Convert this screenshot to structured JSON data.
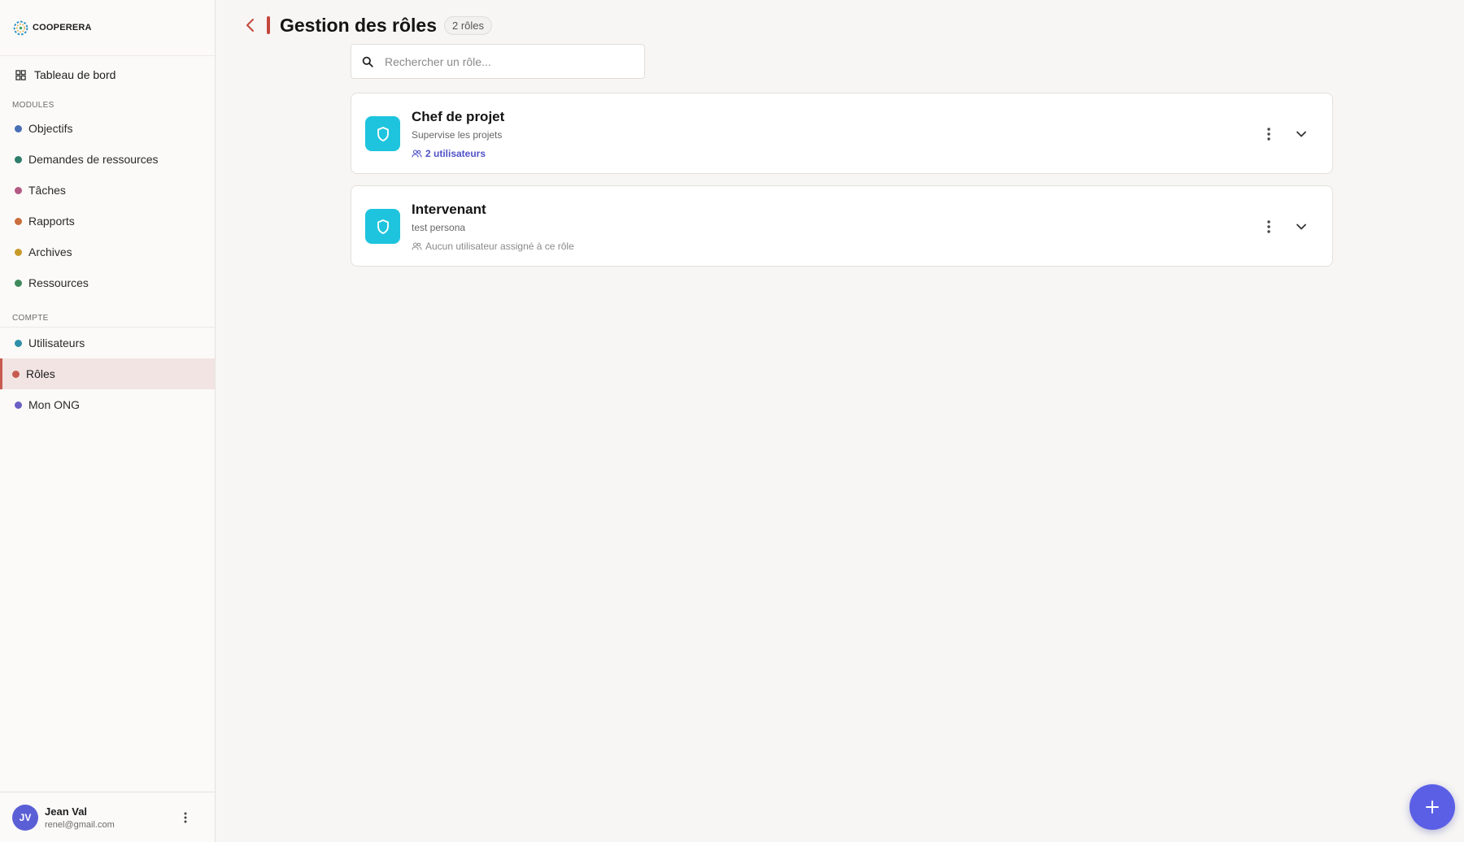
{
  "brand": {
    "name": "COOPERERA",
    "icon": "cooperera-logo"
  },
  "sidebar": {
    "dashboard": {
      "label": "Tableau de bord",
      "icon": "grid-icon"
    },
    "modules_title": "MODULES",
    "modules": [
      {
        "label": "Objectifs",
        "color": "#4a6fb5"
      },
      {
        "label": "Demandes de ressources",
        "color": "#2f7d6d"
      },
      {
        "label": "Tâches",
        "color": "#b35a84"
      },
      {
        "label": "Rapports",
        "color": "#c96e3c"
      },
      {
        "label": "Archives",
        "color": "#c89a2a"
      },
      {
        "label": "Ressources",
        "color": "#3f8a5c"
      }
    ],
    "compte_title": "COMPTE",
    "compte": [
      {
        "label": "Utilisateurs",
        "color": "#2f8fa8"
      },
      {
        "label": "Rôles",
        "color": "#c75a4f",
        "active": true
      },
      {
        "label": "Mon ONG",
        "color": "#6a5fc4"
      }
    ]
  },
  "user": {
    "initials": "JV",
    "name": "Jean Val",
    "email": "renel@gmail.com"
  },
  "header": {
    "title": "Gestion des rôles",
    "count": "2 rôles"
  },
  "search": {
    "placeholder": "Rechercher un rôle...",
    "value": ""
  },
  "roles": [
    {
      "name": "Chef de projet",
      "description": "Supervise les projets",
      "users": "2 utilisateurs",
      "has_users": true
    },
    {
      "name": "Intervenant",
      "description": "test persona",
      "users": "Aucun utilisateur assigné à ce rôle",
      "has_users": false
    }
  ],
  "colors": {
    "accent": "#5b5fe6",
    "role_tile": "#1ec4de",
    "active_marker": "#c75a4f"
  }
}
